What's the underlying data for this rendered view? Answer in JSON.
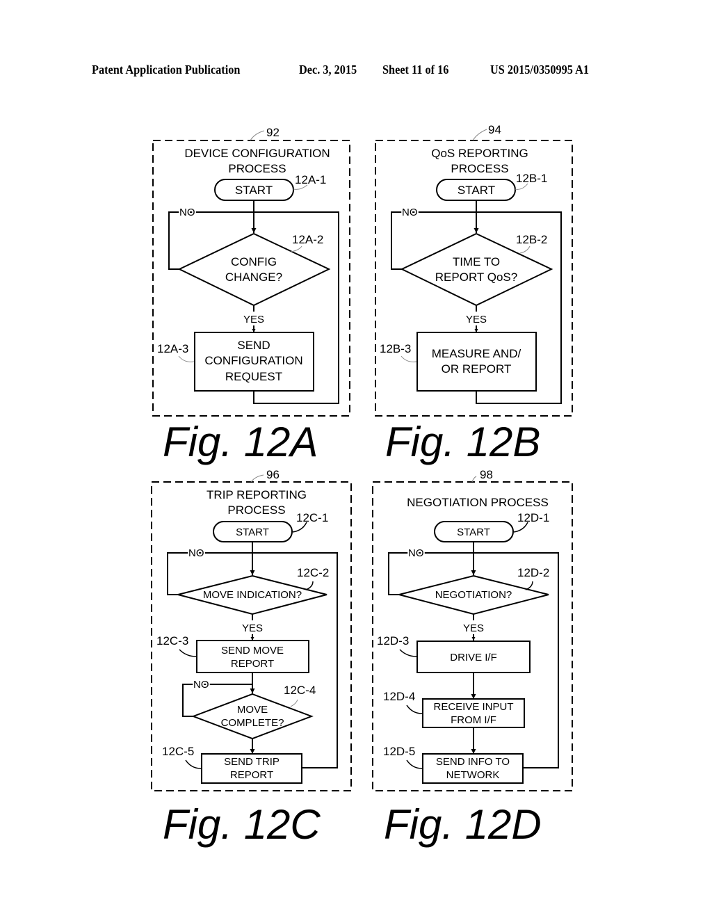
{
  "header": {
    "publication": "Patent Application Publication",
    "date": "Dec. 3, 2015",
    "sheet": "Sheet 11 of 16",
    "number": "US 2015/0350995 A1"
  },
  "figures": {
    "a": {
      "ref": "92",
      "title_lines": [
        "DEVICE CONFIGURATION",
        "PROCESS"
      ],
      "caption": "Fig. 12A",
      "start": {
        "id": "12A-1",
        "label": "START"
      },
      "decision": {
        "id": "12A-2",
        "lines": [
          "CONFIG",
          "CHANGE?"
        ]
      },
      "action": {
        "id": "12A-3",
        "lines": [
          "SEND",
          "CONFIGURATION",
          "REQUEST"
        ]
      },
      "no_label": "NO",
      "yes_label": "YES"
    },
    "b": {
      "ref": "94",
      "title_lines": [
        "QoS REPORTING",
        "PROCESS"
      ],
      "caption": "Fig. 12B",
      "start": {
        "id": "12B-1",
        "label": "START"
      },
      "decision": {
        "id": "12B-2",
        "lines": [
          "TIME TO",
          "REPORT QoS?"
        ]
      },
      "action": {
        "id": "12B-3",
        "lines": [
          "MEASURE AND/",
          "OR REPORT"
        ]
      },
      "no_label": "NO",
      "yes_label": "YES"
    },
    "c": {
      "ref": "96",
      "title_lines": [
        "TRIP REPORTING",
        "PROCESS"
      ],
      "caption": "Fig. 12C",
      "start": {
        "id": "12C-1",
        "label": "START"
      },
      "decision1": {
        "id": "12C-2",
        "label": "MOVE INDICATION?"
      },
      "action1": {
        "id": "12C-3",
        "lines": [
          "SEND MOVE",
          "REPORT"
        ]
      },
      "decision2": {
        "id": "12C-4",
        "lines": [
          "MOVE",
          "COMPLETE?"
        ]
      },
      "action2": {
        "id": "12C-5",
        "lines": [
          "SEND TRIP",
          "REPORT"
        ]
      },
      "no_label": "NO",
      "no_label2": "NO",
      "yes_label": "YES"
    },
    "d": {
      "ref": "98",
      "title": "NEGOTIATION PROCESS",
      "caption": "Fig. 12D",
      "start": {
        "id": "12D-1",
        "label": "START"
      },
      "decision": {
        "id": "12D-2",
        "label": "NEGOTIATION?"
      },
      "action1": {
        "id": "12D-3",
        "label": "DRIVE I/F"
      },
      "action2": {
        "id": "12D-4",
        "lines": [
          "RECEIVE INPUT",
          "FROM I/F"
        ]
      },
      "action3": {
        "id": "12D-5",
        "lines": [
          "SEND INFO TO",
          "NETWORK"
        ]
      },
      "no_label": "NO",
      "yes_label": "YES"
    }
  }
}
